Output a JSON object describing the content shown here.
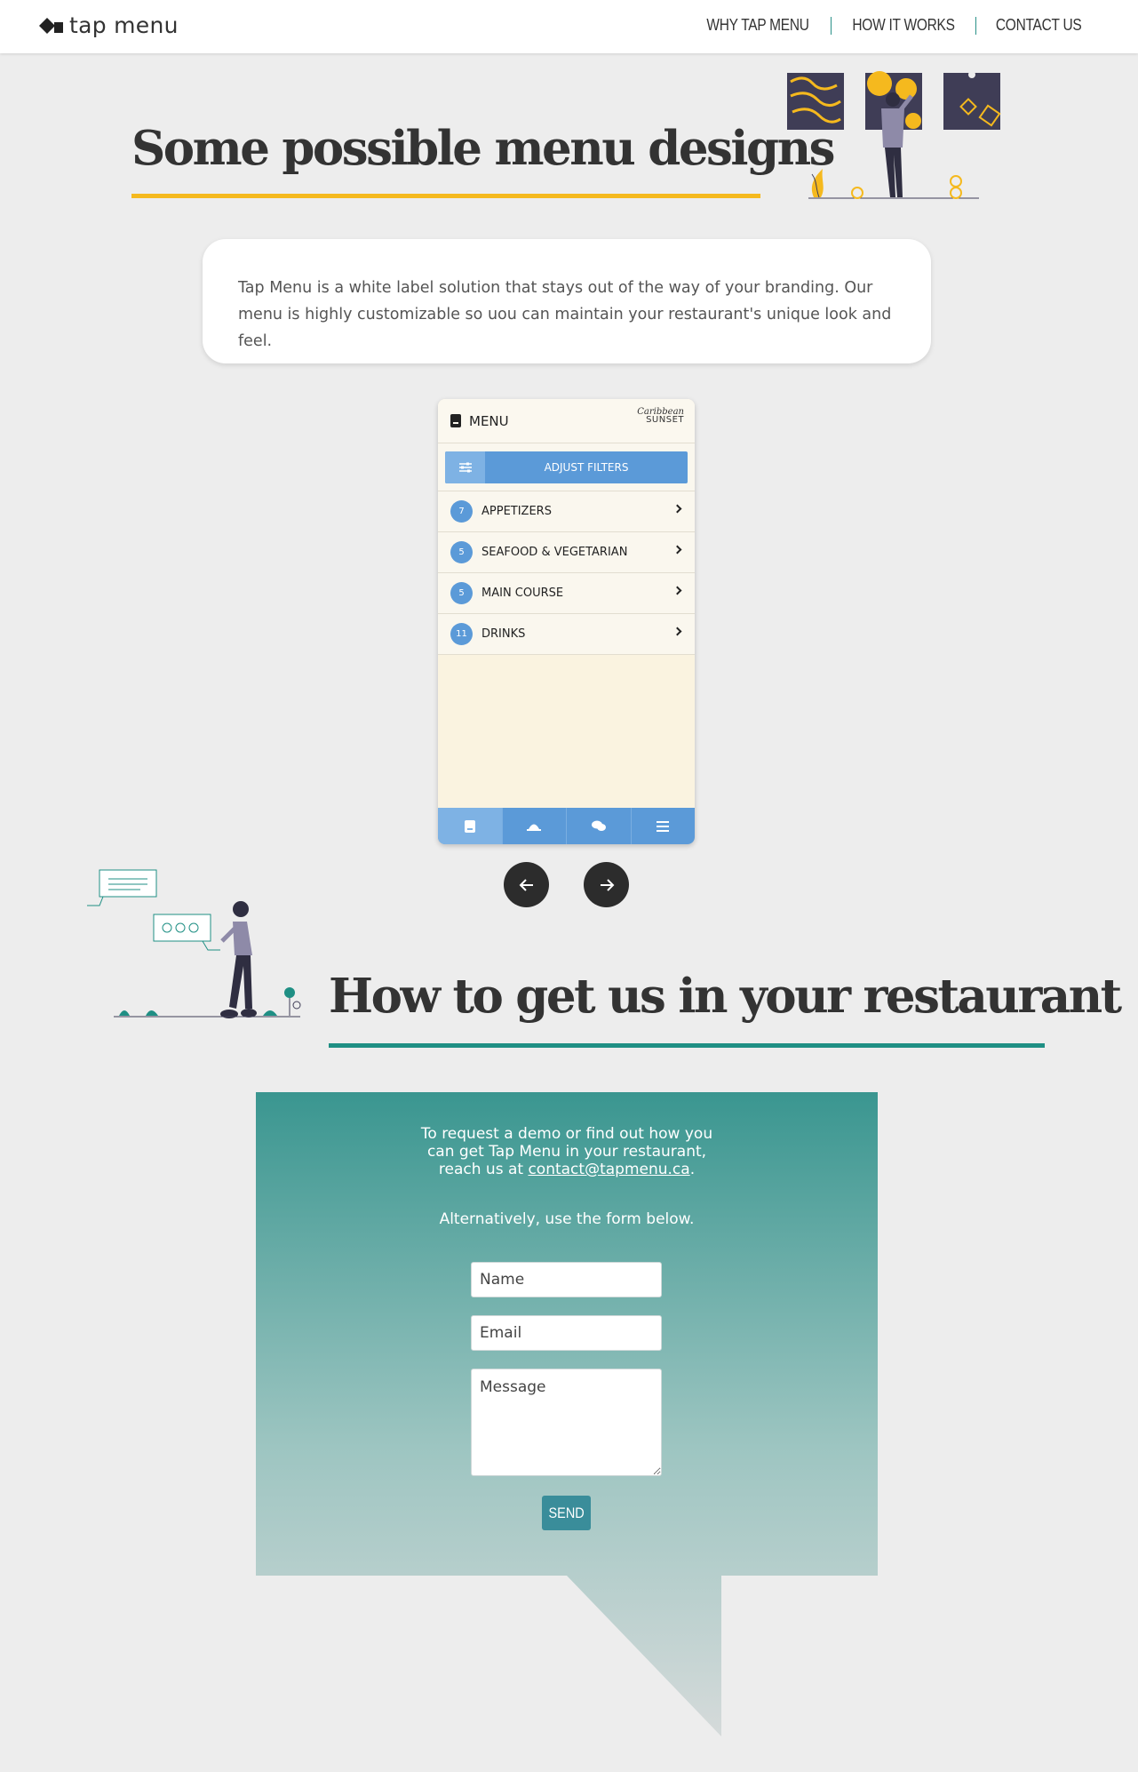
{
  "nav": {
    "logo_text": "tap menu",
    "links": [
      "WHY TAP MENU",
      "HOW IT WORKS",
      "CONTACT US"
    ]
  },
  "designs": {
    "heading": "Some possible menu designs",
    "intro": "Tap Menu is a white label solution that stays out of the way of your branding. Our menu is highly customizable so uou can maintain your restaurant's unique look and feel."
  },
  "phone": {
    "header_label": "MENU",
    "brand_line1": "Caribbean",
    "brand_line2": "SUNSET",
    "filter_label": "ADJUST FILTERS",
    "categories": [
      {
        "count": "7",
        "label": "APPETIZERS"
      },
      {
        "count": "5",
        "label": "SEAFOOD & VEGETARIAN"
      },
      {
        "count": "5",
        "label": "MAIN COURSE"
      },
      {
        "count": "11",
        "label": "DRINKS"
      }
    ],
    "tabs": [
      "menu-book-icon",
      "cloche-icon",
      "chat-icon",
      "hamburger-icon"
    ]
  },
  "slider": {
    "prev_icon": "arrow-left-icon",
    "next_icon": "arrow-right-icon"
  },
  "restaurant": {
    "heading": "How to get us in your restaurant"
  },
  "contact": {
    "intro_before": "To request a demo or find out how you can get Tap Menu in your restaurant, reach us at ",
    "email": "contact@tapmenu.ca",
    "intro_after": ".",
    "alt_text": "Alternatively, use the form below.",
    "name_placeholder": "Name",
    "email_placeholder": "Email",
    "message_placeholder": "Message",
    "send_label": "SEND"
  },
  "colors": {
    "accent_yellow": "#f5b91e",
    "accent_teal": "#1f8f84",
    "phone_blue": "#5b9ad8",
    "send_button": "#3a8d9a"
  }
}
